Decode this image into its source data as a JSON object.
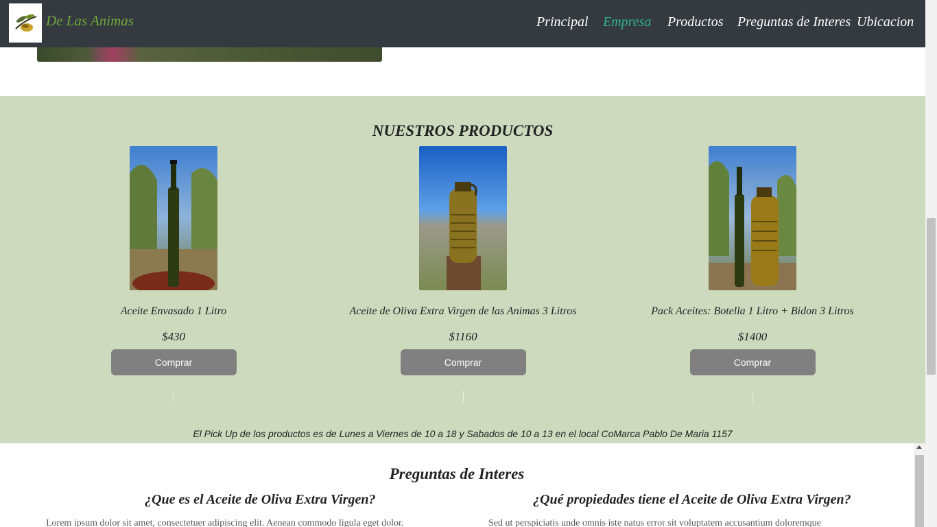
{
  "brand": {
    "name": "De Las Animas",
    "logo_icon": "olive-branch-logo"
  },
  "nav": {
    "items": [
      {
        "label": "Principal",
        "active": false
      },
      {
        "label": "Empresa",
        "active": true
      },
      {
        "label": "Productos",
        "active": false
      },
      {
        "label": "Preguntas de Interes",
        "active": false
      },
      {
        "label": "Ubicacion",
        "active": false
      }
    ]
  },
  "products": {
    "title": "NUESTROS PRODUCTOS",
    "items": [
      {
        "name": "Aceite Envasado 1 Litro",
        "price": "$430",
        "button": "Comprar"
      },
      {
        "name": "Aceite de Oliva Extra Virgen de las Animas 3 Litros",
        "price": "$1160",
        "button": "Comprar"
      },
      {
        "name": "Pack Aceites: Botella 1 Litro + Bidon 3 Litros",
        "price": "$1400",
        "button": "Comprar"
      }
    ],
    "pickup": "El Pick Up de los productos es de Lunes a Viernes de 10 a 18 y Sabados de 10 a 13 en el local CoMarca Pablo De Maria 1157"
  },
  "faq": {
    "title": "Preguntas de Interes",
    "questions": [
      {
        "q": "¿Que es el Aceite de Oliva Extra Virgen?",
        "a": "Lorem ipsum dolor sit amet, consectetuer adipiscing elit. Aenean commodo ligula eget dolor."
      },
      {
        "q": "¿Qué propiedades tiene el Aceite de Oliva Extra Virgen?",
        "a": "Sed ut perspiciatis unde omnis iste natus error sit voluptatem accusantium doloremque"
      }
    ]
  },
  "colors": {
    "navbar": "#343a40",
    "brand": "#6fa83a",
    "active_nav": "#2fb38a",
    "products_bg": "#cddabe",
    "button": "#808080"
  }
}
